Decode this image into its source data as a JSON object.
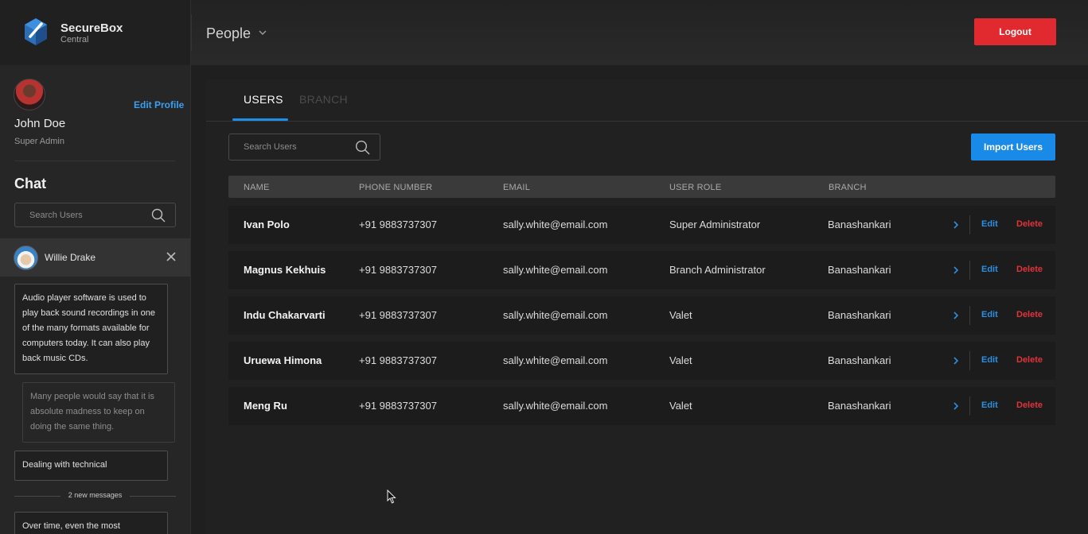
{
  "brand": {
    "name": "SecureBox",
    "sub": "Central"
  },
  "profile": {
    "name": "John Doe",
    "role": "Super Admin",
    "edit_label": "Edit Profile"
  },
  "chat": {
    "title": "Chat",
    "search_placeholder": "Search Users",
    "active_user": "Willie Drake",
    "messages": [
      "Audio player software is used to play back sound recordings in one of the many formats available for computers today. It can also play back music CDs.",
      "Many people would say that it is absolute madness to keep on doing the same thing.",
      "Dealing with technical",
      "Over time, even the most"
    ],
    "new_messages_label": "2 new messages"
  },
  "header": {
    "page_title": "People",
    "logout_label": "Logout"
  },
  "tabs": [
    {
      "label": "USERS",
      "active": true
    },
    {
      "label": "BRANCH",
      "active": false
    }
  ],
  "users_toolbar": {
    "search_placeholder": "Search Users",
    "import_label": "Import Users"
  },
  "table": {
    "headers": {
      "name": "NAME",
      "phone": "PHONE NUMBER",
      "email": "EMAIL",
      "role": "USER ROLE",
      "branch": "BRANCH"
    },
    "edit_label": "Edit",
    "delete_label": "Delete",
    "rows": [
      {
        "name": "Ivan Polo",
        "phone": "+91 9883737307",
        "email": "sally.white@email.com",
        "role": "Super Administrator",
        "branch": "Banashankari"
      },
      {
        "name": "Magnus Kekhuis",
        "phone": "+91 9883737307",
        "email": "sally.white@email.com",
        "role": "Branch Administrator",
        "branch": "Banashankari"
      },
      {
        "name": "Indu Chakarvarti",
        "phone": "+91 9883737307",
        "email": "sally.white@email.com",
        "role": "Valet",
        "branch": "Banashankari"
      },
      {
        "name": "Uruewa Himona",
        "phone": "+91 9883737307",
        "email": "sally.white@email.com",
        "role": "Valet",
        "branch": "Banashankari"
      },
      {
        "name": "Meng Ru",
        "phone": "+91 9883737307",
        "email": "sally.white@email.com",
        "role": "Valet",
        "branch": "Banashankari"
      }
    ]
  },
  "colors": {
    "accent": "#1a8ae8",
    "danger": "#e02a2f",
    "background": "#1f1f20"
  },
  "icons": [
    "logo-icon",
    "search-icon",
    "close-icon",
    "chevron-down-icon",
    "chevron-right-icon",
    "cursor-icon"
  ]
}
